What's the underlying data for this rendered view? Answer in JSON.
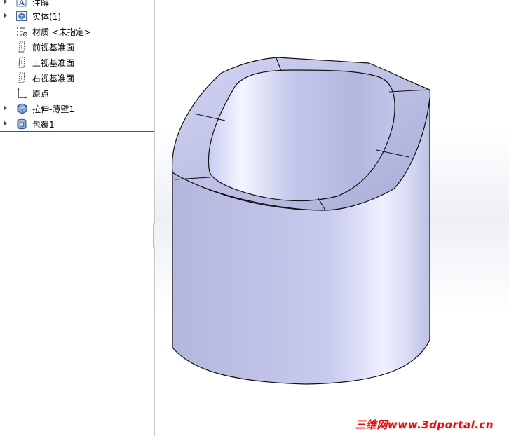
{
  "feature_tree": {
    "items": [
      {
        "label": "注解",
        "expandable": true,
        "icon": "annotation-icon"
      },
      {
        "label": "实体(1)",
        "expandable": true,
        "icon": "solid-bodies-icon"
      },
      {
        "label": "材质 <未指定>",
        "expandable": false,
        "icon": "material-icon"
      },
      {
        "label": "前视基准面",
        "expandable": false,
        "icon": "plane-icon"
      },
      {
        "label": "上视基准面",
        "expandable": false,
        "icon": "plane-icon"
      },
      {
        "label": "右视基准面",
        "expandable": false,
        "icon": "plane-icon"
      },
      {
        "label": "原点",
        "expandable": false,
        "icon": "origin-icon"
      },
      {
        "label": "拉伸-薄壁1",
        "expandable": true,
        "icon": "extrude-thin-icon"
      },
      {
        "label": "包覆1",
        "expandable": true,
        "icon": "wrap-icon"
      }
    ]
  },
  "viewport": {
    "model_color": "#c3c6ea",
    "edge_color": "#000000"
  },
  "watermark": {
    "text": "三维网www.3dportal.cn",
    "color": "#e01010"
  }
}
